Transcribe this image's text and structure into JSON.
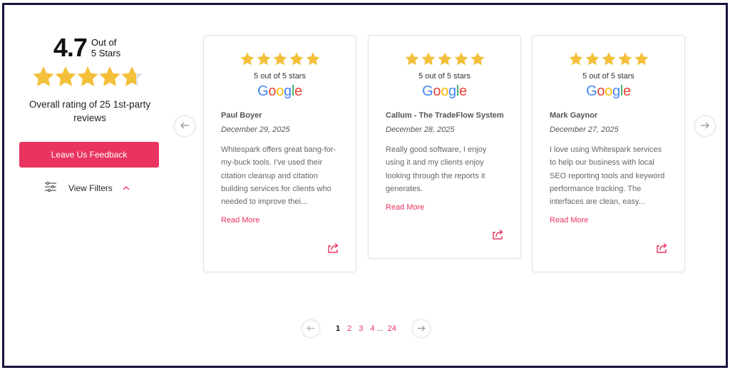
{
  "summary": {
    "rating": "4.7",
    "out_of_line1": "Out of",
    "out_of_line2": "5 Stars",
    "stars_value": 4.7,
    "overall_text": "Overall rating of 25 1st-party reviews",
    "feedback_label": "Leave Us Feedback",
    "filters_label": "View Filters"
  },
  "colors": {
    "accent": "#e9345f",
    "star": "#f4c03b",
    "star_empty": "#e0e0e0"
  },
  "reviews": [
    {
      "stars": 5,
      "score_text": "5 out of 5 stars",
      "source": "Google",
      "name": "Paul Boyer",
      "date": "December 29, 2025",
      "body": "Whitespark offers great bang-for-my-buck tools. I've used their citation cleanup and citation building services for clients who needed to improve thei...",
      "read_more": "Read More"
    },
    {
      "stars": 5,
      "score_text": "5 out of 5 stars",
      "source": "Google",
      "name": "Callum - The TradeFlow System",
      "date": "December 28, 2025",
      "body": "Really good software, I enjoy using it and my clients enjoy looking through the reports it generates.",
      "read_more": "Read More"
    },
    {
      "stars": 5,
      "score_text": "5 out of 5 stars",
      "source": "Google",
      "name": "Mark Gaynor",
      "date": "December 27, 2025",
      "body": "I love using Whitespark services to help our business with local SEO reporting tools and keyword performance tracking. The interfaces are clean, easy...",
      "read_more": "Read More"
    }
  ],
  "pagination": {
    "current": "1",
    "pages": [
      "2",
      "3",
      "4"
    ],
    "ellipsis": "...",
    "last": "24"
  }
}
